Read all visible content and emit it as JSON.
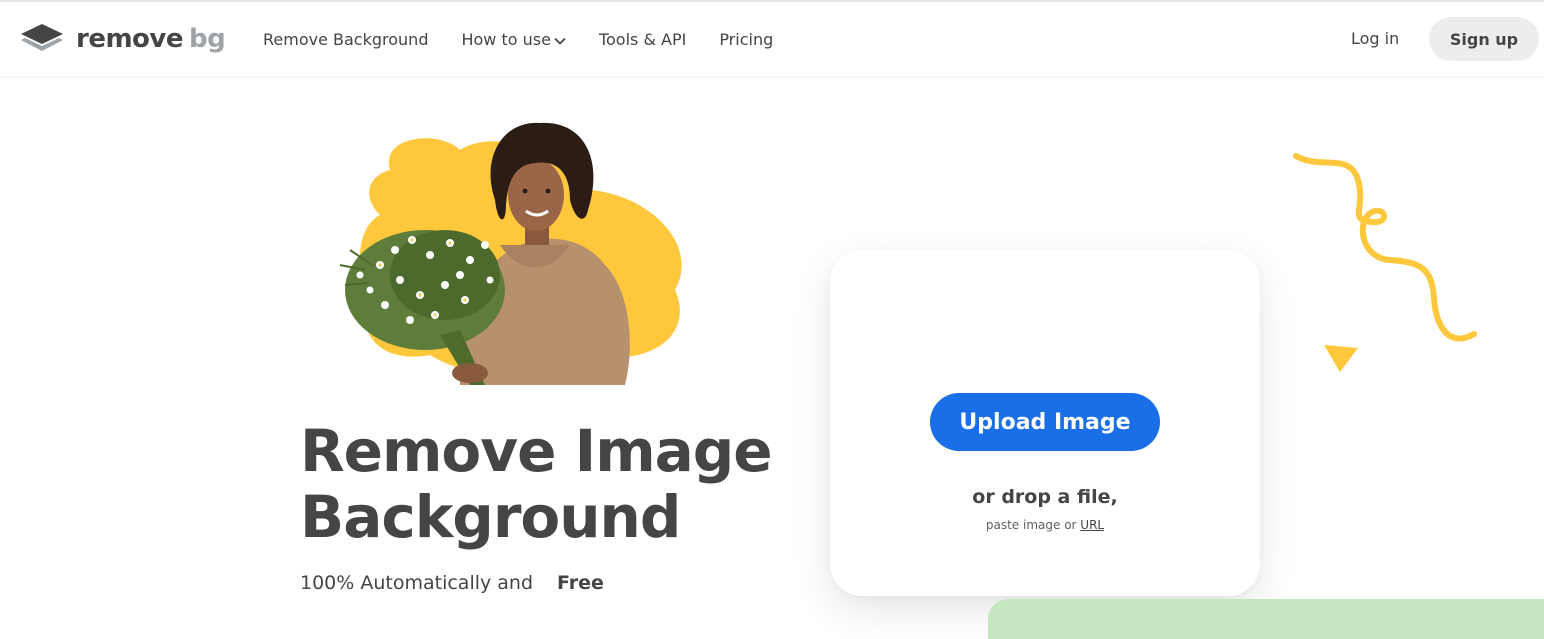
{
  "app": {
    "logo_word": "remove",
    "logo_suffix": "bg"
  },
  "nav": {
    "items": [
      {
        "label": "Remove Background"
      },
      {
        "label": "How to use",
        "has_dropdown": true
      },
      {
        "label": "Tools & API"
      },
      {
        "label": "Pricing"
      }
    ],
    "login_label": "Log in",
    "signup_label": "Sign up"
  },
  "hero": {
    "title_line1": "Remove Image",
    "title_line2": "Background",
    "subtitle_prefix": "100% Automatically and",
    "subtitle_badge": "Free"
  },
  "upload": {
    "button_label": "Upload Image",
    "drop_text": "or drop a file,",
    "paste_prefix": "paste image or",
    "url_link": "URL"
  },
  "colors": {
    "primary": "#1a6fe8",
    "accent_yellow": "#ffc73c",
    "text": "#454545",
    "signup_bg": "#ecedef",
    "green_panel": "#c4e7c0"
  },
  "icons": [
    "logo-layers-icon",
    "chevron-down-icon",
    "squiggle-decoration",
    "triangle-decoration"
  ]
}
